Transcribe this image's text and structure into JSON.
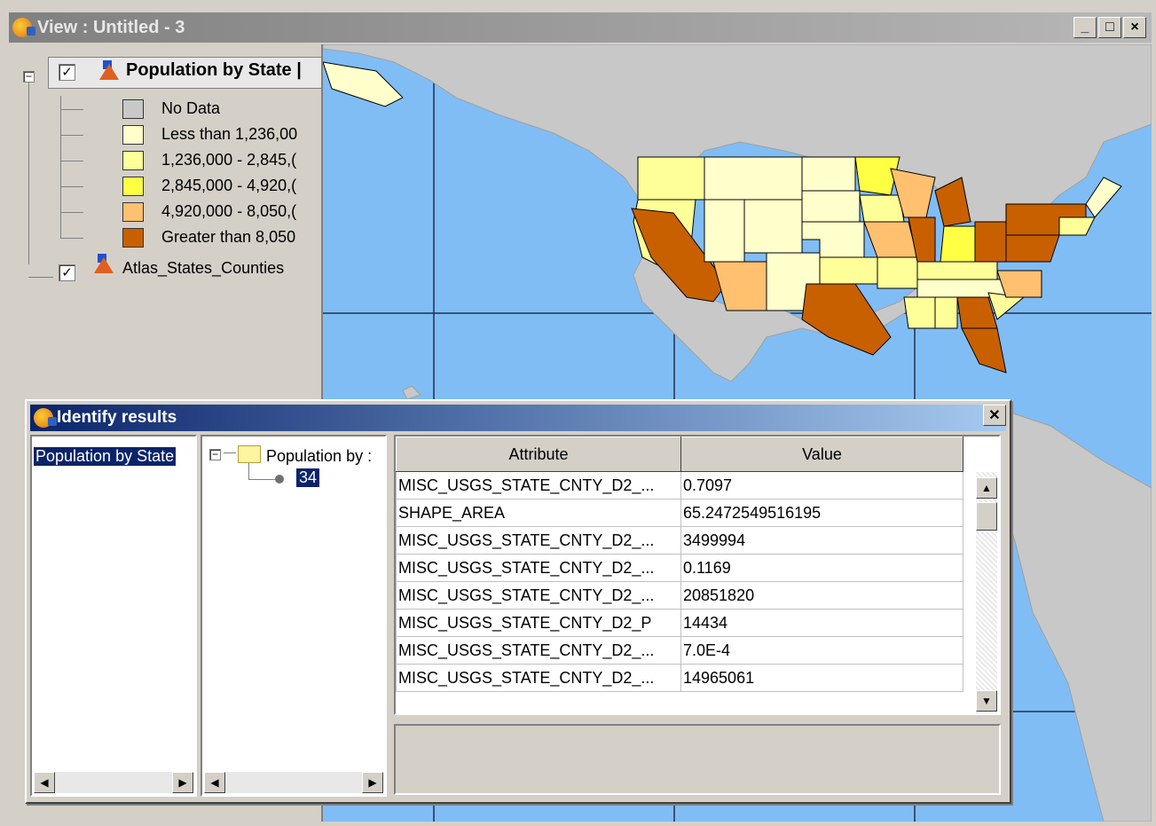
{
  "window": {
    "title": "View : Untitled - 3",
    "buttons": [
      "_",
      "□",
      "×"
    ]
  },
  "toc": {
    "layer1": "Population by State |",
    "legend": [
      {
        "label": "No Data",
        "color": "#c8c8c8"
      },
      {
        "label": "Less than 1,236,00",
        "color": "#ffffcc"
      },
      {
        "label": "1,236,000 - 2,845,(",
        "color": "#ffff99"
      },
      {
        "label": "2,845,000 - 4,920,(",
        "color": "#ffff44"
      },
      {
        "label": "4,920,000 - 8,050,(",
        "color": "#ffc070"
      },
      {
        "label": "Greater than 8,050",
        "color": "#c86000"
      }
    ],
    "layer2": "Atlas_States_Counties"
  },
  "dialog": {
    "title": "Identify results",
    "layers_list": [
      "Population by State"
    ],
    "tree_root": "Population by :",
    "tree_child": "34",
    "columns": [
      "Attribute",
      "Value"
    ],
    "rows": [
      [
        "MISC_USGS_STATE_CNTY_D2_...",
        "0.7097"
      ],
      [
        "SHAPE_AREA",
        "65.2472549516195"
      ],
      [
        "MISC_USGS_STATE_CNTY_D2_...",
        "3499994"
      ],
      [
        "MISC_USGS_STATE_CNTY_D2_...",
        "0.1169"
      ],
      [
        "MISC_USGS_STATE_CNTY_D2_...",
        "20851820"
      ],
      [
        "MISC_USGS_STATE_CNTY_D2_P",
        "14434"
      ],
      [
        "MISC_USGS_STATE_CNTY_D2_...",
        "7.0E-4"
      ],
      [
        "MISC_USGS_STATE_CNTY_D2_...",
        "14965061"
      ]
    ]
  },
  "colors": {
    "ocean": "#80bdf5",
    "land": "#c8c8c8",
    "selection": "#0a246a"
  }
}
